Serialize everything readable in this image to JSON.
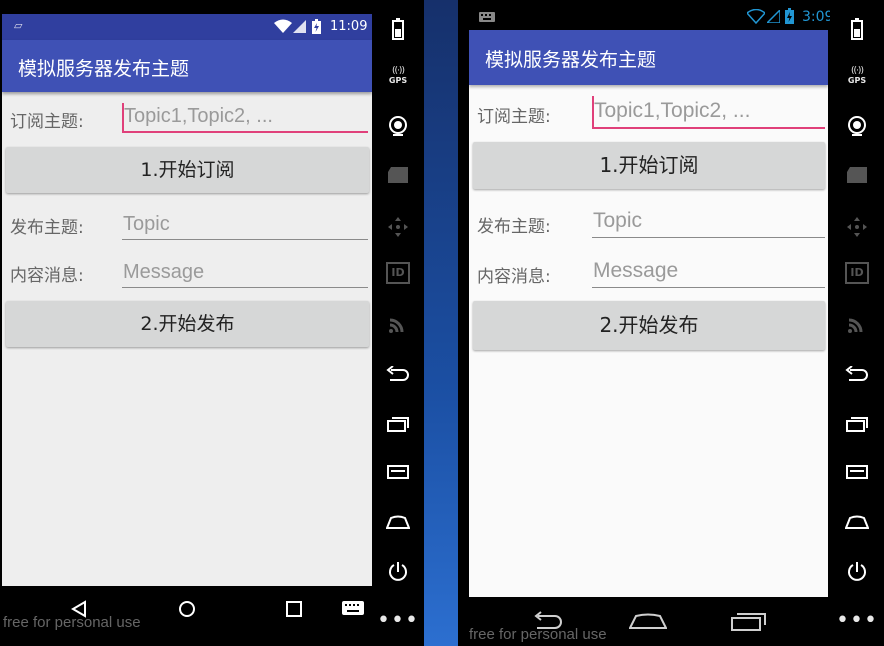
{
  "left_emulator": {
    "status": {
      "time": "11:09"
    },
    "app_title": "模拟服务器发布主题",
    "subscribe": {
      "label": "订阅主题:",
      "placeholder": "Topic1,Topic2, ...",
      "button": "1.开始订阅"
    },
    "publish": {
      "topic_label": "发布主题:",
      "topic_placeholder": "Topic",
      "message_label": "内容消息:",
      "message_placeholder": "Message",
      "button": "2.开始发布"
    },
    "watermark": "free for personal use"
  },
  "right_emulator": {
    "status": {
      "time": "3:09"
    },
    "app_title": "模拟服务器发布主题",
    "subscribe": {
      "label": "订阅主题:",
      "placeholder": "Topic1,Topic2, ...",
      "button": "1.开始订阅"
    },
    "publish": {
      "topic_label": "发布主题:",
      "topic_placeholder": "Topic",
      "message_label": "内容消息:",
      "message_placeholder": "Message",
      "button": "2.开始发布"
    },
    "watermark": "free for personal use"
  },
  "sidebar": {
    "gps_label": "GPS",
    "id_label": "ID"
  },
  "colors": {
    "primary": "#3f51b5",
    "primary_dark": "#303f9f",
    "accent": "#e0407a",
    "button": "#d6d7d7",
    "status_accent": "#2196d3"
  }
}
